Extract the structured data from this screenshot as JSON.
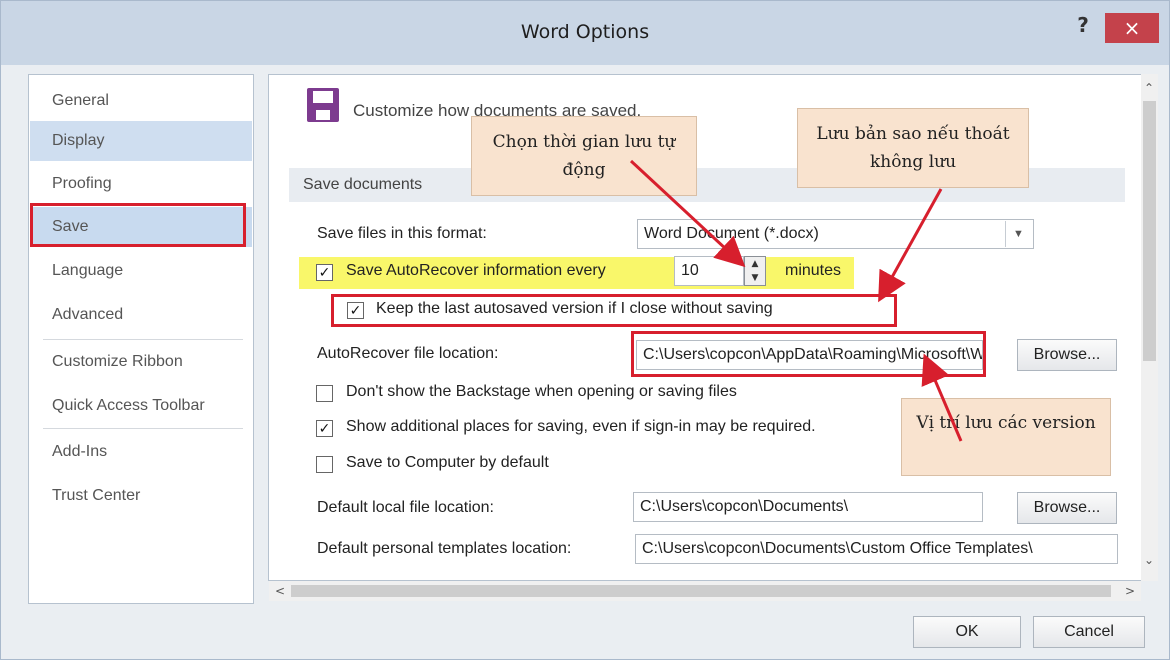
{
  "window": {
    "title": "Word Options",
    "help": "?",
    "close": "×"
  },
  "nav": [
    "General",
    "Display",
    "Proofing",
    "Save",
    "Language",
    "Advanced",
    "Customize Ribbon",
    "Quick Access Toolbar",
    "Add-Ins",
    "Trust Center"
  ],
  "content": {
    "headline": "Customize how documents are saved.",
    "section": "Save documents",
    "format_label": "Save files in this format:",
    "format_value": "Word Document (*.docx)",
    "autorecover_label": "Save AutoRecover information every",
    "autorecover_value": "10",
    "minutes": "minutes",
    "keep_label": "Keep the last autosaved version if I close without saving",
    "ar_loc_label": "AutoRecover file location:",
    "ar_loc_value": "C:\\Users\\copcon\\AppData\\Roaming\\Microsoft\\Word\\",
    "browse": "Browse...",
    "backstage_label": "Don't show the Backstage when opening or saving files",
    "additional_label": "Show additional places for saving, even if sign-in may be required.",
    "computer_label": "Save to Computer by default",
    "local_label": "Default local file location:",
    "local_value": "C:\\Users\\copcon\\Documents\\",
    "templates_label": "Default personal templates location:",
    "templates_value": "C:\\Users\\copcon\\Documents\\Custom Office Templates\\"
  },
  "checkboxes": {
    "autorecover": true,
    "keep": true,
    "backstage": false,
    "additional": true,
    "computer": false
  },
  "annotations": {
    "note1": "Chọn thời gian lưu tự động",
    "note2": "Lưu bản sao nếu thoát không lưu",
    "note3": "Vị trí lưu các version"
  },
  "footer": {
    "ok": "OK",
    "cancel": "Cancel"
  }
}
